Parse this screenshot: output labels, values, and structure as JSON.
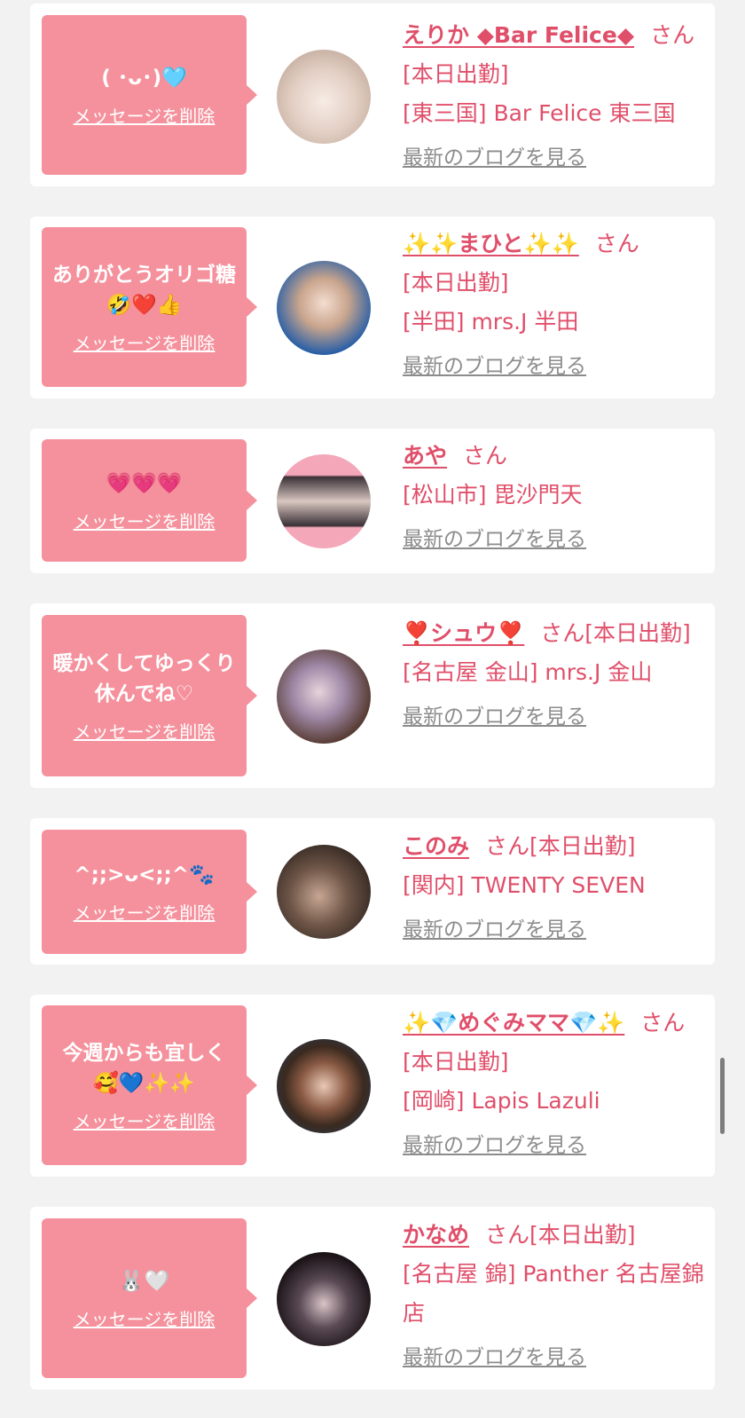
{
  "delete_label": "メッセージを削除",
  "blog_label": "最新のブログを見る",
  "suffix": "さん",
  "colors": {
    "background": "#f2f2f2",
    "card": "#ffffff",
    "bubble": "#f5919c",
    "accent_text": "#e04f6a",
    "link_gray": "#8c8c8c"
  },
  "cards": [
    {
      "message": "( ･ᴗ･)🩵",
      "name": "えりか ◆Bar Felice◆",
      "status": "[本日出勤]",
      "location": "[東三国] Bar Felice 東三国"
    },
    {
      "message": "ありがとうオリゴ糖🤣❤️👍",
      "name": "✨✨まひと✨✨",
      "status": "[本日出勤]",
      "location": "[半田] mrs.J 半田"
    },
    {
      "message": "💗💗💗",
      "name": "あや",
      "status": "",
      "location": "[松山市] 毘沙門天"
    },
    {
      "message": "暖かくしてゆっくり休んでね♡",
      "name": "❣️シュウ❣️",
      "status": "[本日出勤]",
      "location": "[名古屋 金山] mrs.J 金山"
    },
    {
      "message": "^;;>ᴗ<;;^🐾",
      "name": "このみ",
      "status": "[本日出勤]",
      "location": "[関内] TWENTY SEVEN"
    },
    {
      "message": "今週からも宜しく🥰💙✨✨",
      "name": "✨💎めぐみママ💎✨",
      "status": "[本日出勤]",
      "location": "[岡崎] Lapis Lazuli"
    },
    {
      "message": "🐰🤍",
      "name": "かなめ",
      "status": "[本日出勤]",
      "location": "[名古屋 錦] Panther 名古屋錦店"
    }
  ]
}
